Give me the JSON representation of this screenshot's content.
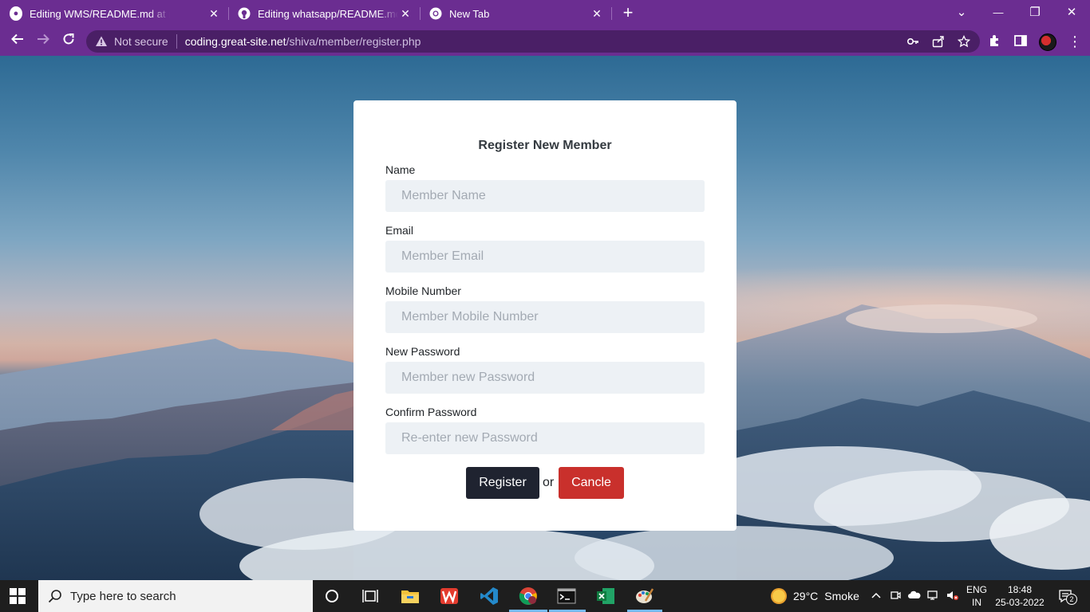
{
  "browser": {
    "tabs": [
      {
        "title": "Editing WMS/README.md at main",
        "icon": "github-icon",
        "active": true
      },
      {
        "title": "Editing whatsapp/README.md at main",
        "icon": "github-icon",
        "active": false
      },
      {
        "title": "New Tab",
        "icon": "chrome-icon",
        "active": false
      }
    ],
    "new_tab": "+",
    "controls": {
      "tab_search": "⌄",
      "minimize": "—",
      "restore": "❐",
      "close": "✕"
    },
    "address": {
      "security_label": "Not secure",
      "host": "coding.great-site.net",
      "path": "/shiva/member/register.php"
    }
  },
  "form": {
    "title": "Register New Member",
    "fields": [
      {
        "label": "Name",
        "placeholder": "Member Name"
      },
      {
        "label": "Email",
        "placeholder": "Member Email"
      },
      {
        "label": "Mobile Number",
        "placeholder": "Member Mobile Number"
      },
      {
        "label": "New Password",
        "placeholder": "Member new Password"
      },
      {
        "label": "Confirm Password",
        "placeholder": "Re-enter new Password"
      }
    ],
    "register_label": "Register",
    "or_text": "or",
    "cancel_label": "Cancle",
    "colors": {
      "register": "#1f2330",
      "cancel": "#c9302c",
      "input_bg": "#edf1f5"
    }
  },
  "taskbar": {
    "search_placeholder": "Type here to search",
    "weather": {
      "temp": "29°C",
      "condition": "Smoke"
    },
    "language": {
      "lang": "ENG",
      "region": "IN"
    },
    "time": "18:48",
    "date": "25-03-2022",
    "notifications": "2"
  },
  "theme": {
    "browser_accent": "#6b2d91"
  }
}
